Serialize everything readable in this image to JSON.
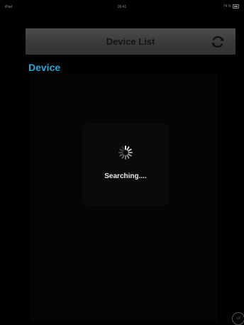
{
  "status_bar": {
    "carrier": "iPad",
    "time": "09:41",
    "battery": "74 %"
  },
  "header": {
    "title": "Device List",
    "refresh_icon": "refresh-icon"
  },
  "section": {
    "label": "Device"
  },
  "loading": {
    "text": "Searching....",
    "icon": "spinner-icon"
  },
  "corner_badge": {
    "label": "1X"
  },
  "colors": {
    "accent": "#2aa5d6",
    "background": "#000000",
    "header": "#3f3f3f"
  }
}
